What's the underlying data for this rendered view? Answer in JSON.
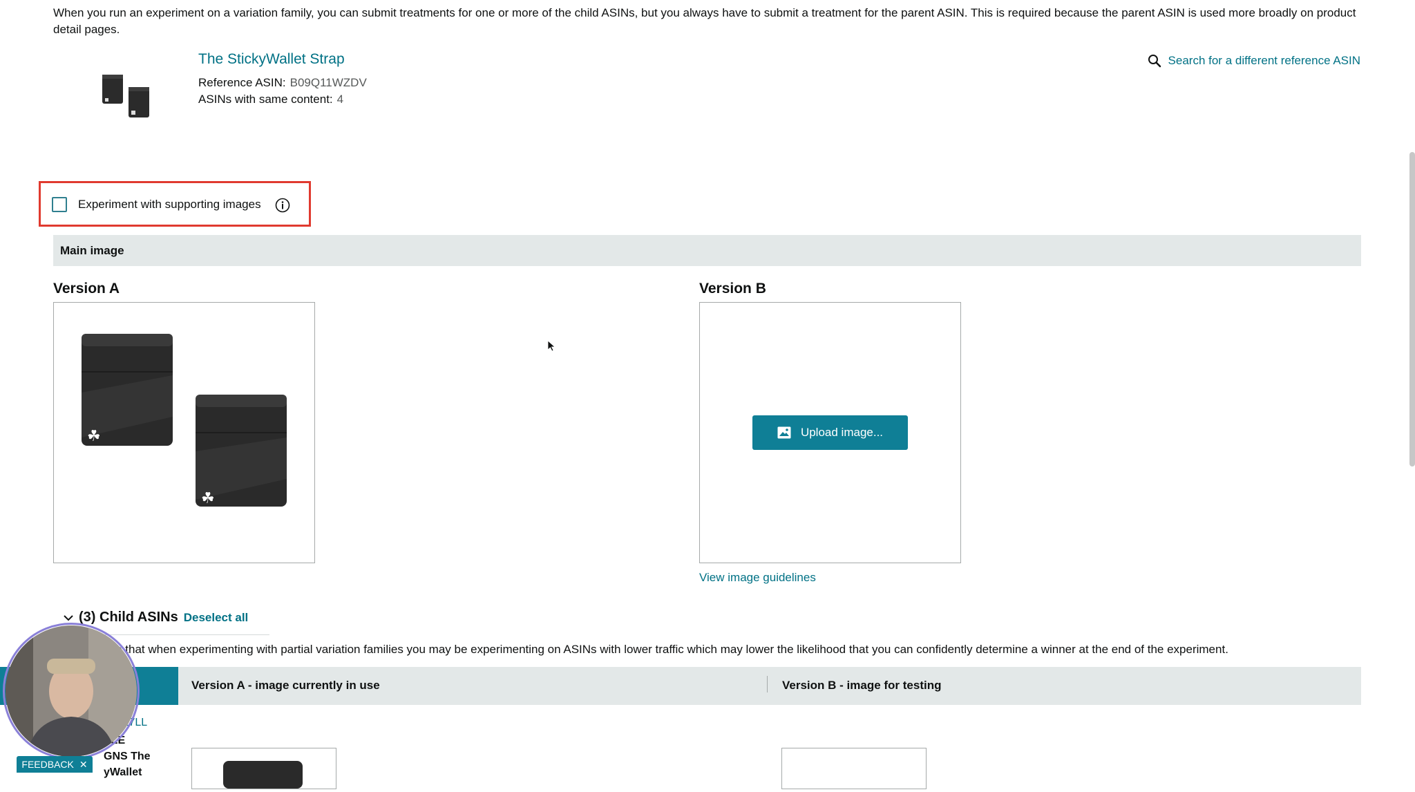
{
  "intro_text": "When you run an experiment on a variation family, you can submit treatments for one or more of the child ASINs, but you always have to submit a treatment for the parent ASIN. This is required because the parent ASIN is used more broadly on product detail pages.",
  "product": {
    "title": "The StickyWallet Strap",
    "reference_asin_label": "Reference ASIN:",
    "reference_asin_value": "B09Q11WZDV",
    "same_content_label": "ASINs with same content:",
    "same_content_value": "4"
  },
  "search_link": "Search for a different reference ASIN",
  "supporting_images": {
    "label": "Experiment with supporting images",
    "checked": false
  },
  "main_image_bar": "Main image",
  "version_a": {
    "heading": "Version A"
  },
  "version_b": {
    "heading": "Version B",
    "upload_button": "Upload image...",
    "guidelines_link": "View image guidelines"
  },
  "child_asins": {
    "header": "(3) Child ASINs",
    "deselect": "Deselect all",
    "warning_visible": "are that when experimenting with partial variation families you may be experimenting on ASINs with lower traffic which may lower the likelihood that you can confidently determine a winner at the end of the experiment.",
    "col_a": "Version A - image currently in use",
    "col_b": "Version B - image for testing",
    "row_asin_partial": "33F27LL",
    "row_name_partial": [
      "YLE",
      "GNS The",
      "yWallet"
    ]
  },
  "feedback": "FEEDBACK",
  "colors": {
    "link": "#007185",
    "teal": "#0f7f96",
    "highlight": "#e03a2f",
    "bar_bg": "#e3e8e8"
  }
}
